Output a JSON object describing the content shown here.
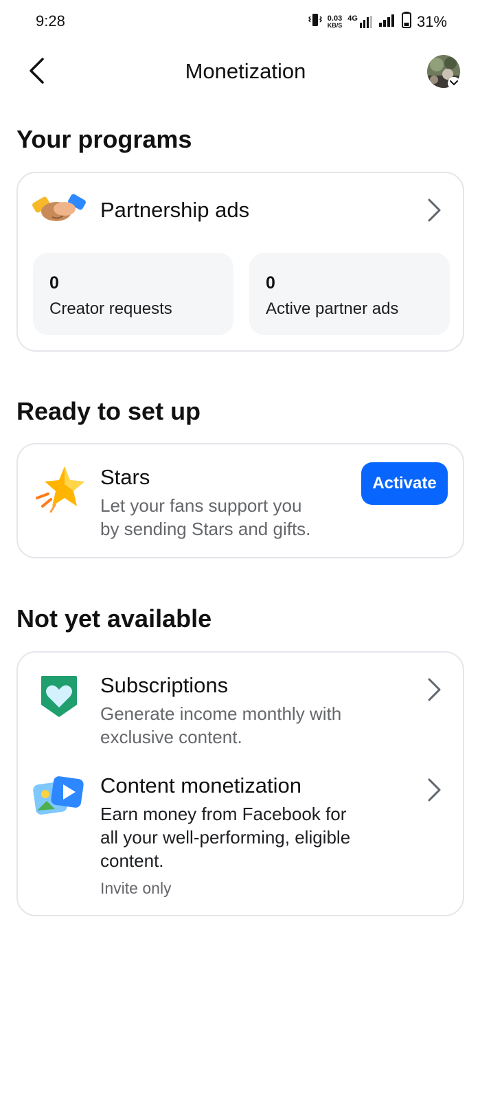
{
  "status_bar": {
    "time": "9:28",
    "net_speed_value": "0.03",
    "net_speed_unit": "KB/S",
    "network_type": "4G",
    "battery_percent": "31%"
  },
  "header": {
    "title": "Monetization"
  },
  "sections": {
    "your_programs": {
      "heading": "Your programs",
      "partnership_ads": {
        "title": "Partnership ads",
        "stats": [
          {
            "value": "0",
            "label": "Creator requests"
          },
          {
            "value": "0",
            "label": "Active partner ads"
          }
        ]
      }
    },
    "ready_to_set_up": {
      "heading": "Ready to set up",
      "stars": {
        "title": "Stars",
        "description_line1": "Let your fans support you",
        "description_line2": "by sending Stars and gifts.",
        "button_label": "Activate"
      }
    },
    "not_yet_available": {
      "heading": "Not yet available",
      "subscriptions": {
        "title": "Subscriptions",
        "description_line1": "Generate income monthly with",
        "description_line2": "exclusive content."
      },
      "content_monetization": {
        "title": "Content monetization",
        "description_line1": "Earn money from Facebook for",
        "description_line2": "all your well-performing, eligible",
        "description_line3": "content.",
        "note": "Invite only"
      }
    }
  },
  "colors": {
    "accent": "#0866ff",
    "card_border": "#e4e6eb",
    "stat_bg": "#f5f6f7",
    "secondary_text": "#65676b"
  },
  "icons": {
    "back": "chevron-left-icon",
    "partnership": "handshake-icon",
    "stars": "star-icon",
    "subscriptions": "heart-badge-icon",
    "content_monetization": "media-play-icon",
    "row_chevron": "chevron-right-icon"
  }
}
